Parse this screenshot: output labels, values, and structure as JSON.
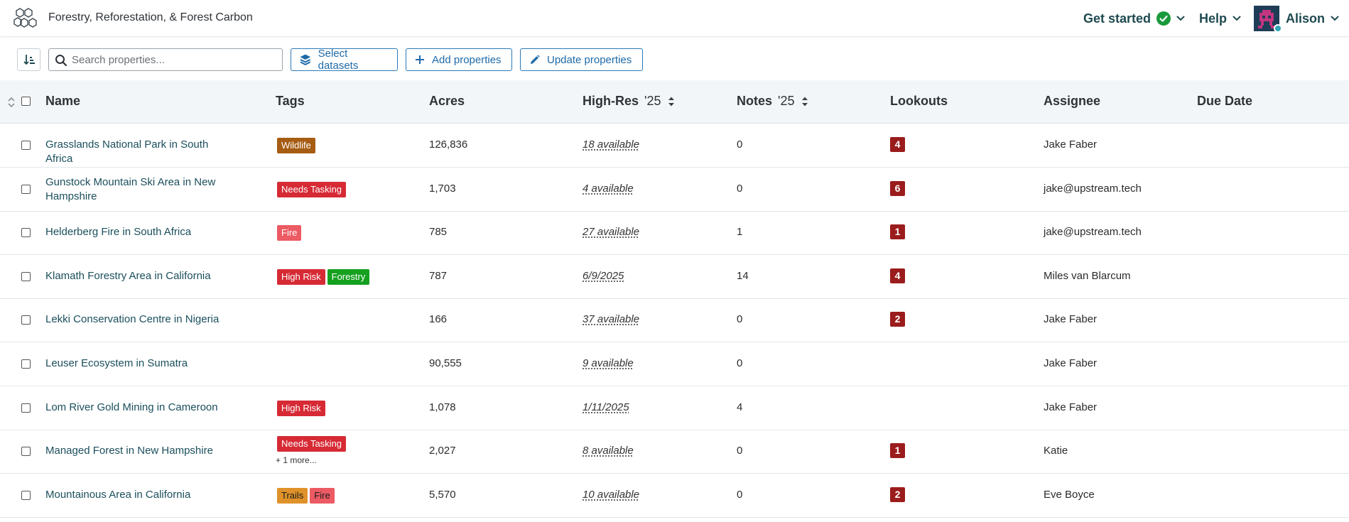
{
  "app": {
    "title": "Forestry, Reforestation, & Forest Carbon"
  },
  "nav": {
    "get_started": "Get started",
    "help": "Help",
    "user": "Alison"
  },
  "toolbar": {
    "search_placeholder": "Search properties...",
    "select_datasets": "Select datasets",
    "add_properties": "Add properties",
    "update_properties": "Update properties"
  },
  "columns": {
    "name": "Name",
    "tags": "Tags",
    "acres": "Acres",
    "highres": "High-Res",
    "highres_sub": "'25",
    "notes": "Notes",
    "notes_sub": "'25",
    "lookouts": "Lookouts",
    "assignee": "Assignee",
    "due_date": "Due Date"
  },
  "colors": {
    "wildlife": "#a65c12",
    "needs_tasking": "#d62a35",
    "fire": "#ec5a63",
    "high_risk": "#d62a35",
    "forestry": "#15a020",
    "trails": "#e0922a",
    "lookout": "#9b1c1c"
  },
  "rows": [
    {
      "name": "Grasslands National Park in South Africa",
      "tags": [
        {
          "label": "Wildlife",
          "color": "#a65c12"
        }
      ],
      "acres": "126,836",
      "highres": "18 available",
      "notes": "0",
      "lookouts": "4",
      "assignee": "Jake Faber"
    },
    {
      "name": "Gunstock Mountain Ski Area in New Hampshire",
      "tags": [
        {
          "label": "Needs Tasking",
          "color": "#d62a35"
        }
      ],
      "acres": "1,703",
      "highres": "4 available",
      "notes": "0",
      "lookouts": "6",
      "assignee": "jake@upstream.tech"
    },
    {
      "name": "Helderberg Fire in South Africa",
      "tags": [
        {
          "label": "Fire",
          "color": "#ec5a63"
        }
      ],
      "acres": "785",
      "highres": "27 available",
      "notes": "1",
      "lookouts": "1",
      "assignee": "jake@upstream.tech"
    },
    {
      "name": "Klamath Forestry Area in California",
      "tags": [
        {
          "label": "High Risk",
          "color": "#d62a35"
        },
        {
          "label": "Forestry",
          "color": "#15a020"
        }
      ],
      "acres": "787",
      "highres": "6/9/2025",
      "notes": "14",
      "lookouts": "4",
      "assignee": "Miles van Blarcum"
    },
    {
      "name": "Lekki Conservation Centre in Nigeria",
      "tags": [],
      "acres": "166",
      "highres": "37 available",
      "notes": "0",
      "lookouts": "2",
      "assignee": "Jake Faber"
    },
    {
      "name": "Leuser Ecosystem in Sumatra",
      "tags": [],
      "acres": "90,555",
      "highres": "9 available",
      "notes": "0",
      "lookouts": "",
      "assignee": "Jake Faber"
    },
    {
      "name": "Lom River Gold Mining in Cameroon",
      "tags": [
        {
          "label": "High Risk",
          "color": "#d62a35"
        }
      ],
      "acres": "1,078",
      "highres": "1/11/2025",
      "notes": "4",
      "lookouts": "",
      "assignee": "Jake Faber"
    },
    {
      "name": "Managed Forest in New Hampshire",
      "tags": [
        {
          "label": "Needs Tasking",
          "color": "#d62a35"
        }
      ],
      "more": "+ 1 more...",
      "acres": "2,027",
      "highres": "8 available",
      "notes": "0",
      "lookouts": "1",
      "assignee": "Katie"
    },
    {
      "name": "Mountainous Area in California",
      "tags": [
        {
          "label": "Trails",
          "color": "#e0922a",
          "dark": true
        },
        {
          "label": "Fire",
          "color": "#ec5a63",
          "dark": true
        }
      ],
      "acres": "5,570",
      "highres": "10 available",
      "notes": "0",
      "lookouts": "2",
      "assignee": "Eve Boyce"
    }
  ]
}
